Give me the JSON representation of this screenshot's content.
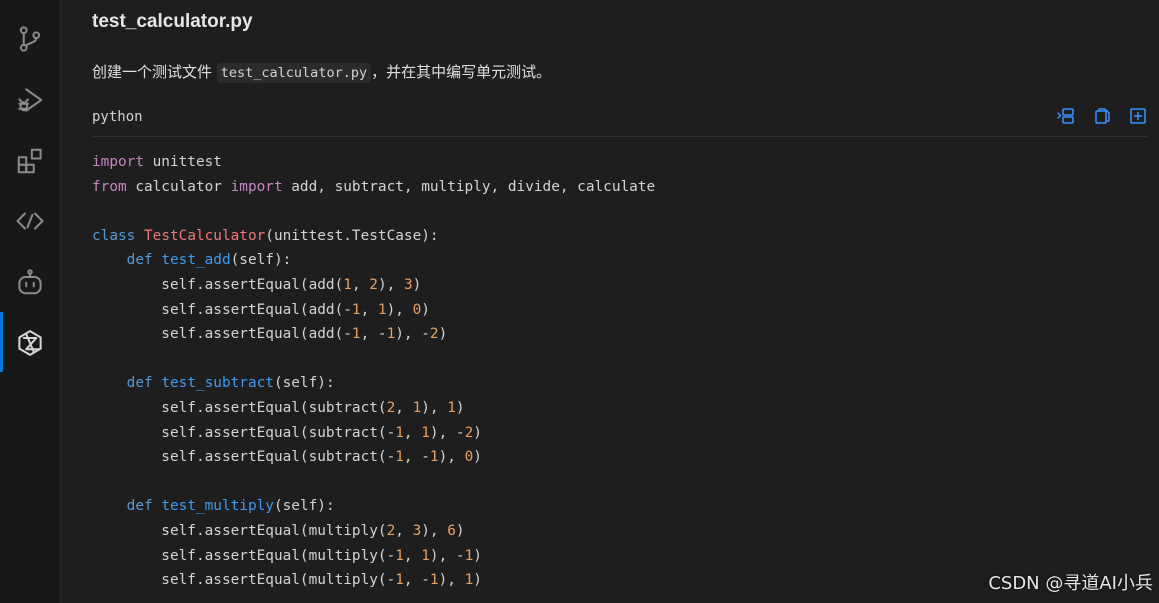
{
  "activity_bar": {
    "items": [
      {
        "name": "source-control-icon"
      },
      {
        "name": "run-debug-icon"
      },
      {
        "name": "extensions-icon"
      },
      {
        "name": "remote-explorer-icon"
      },
      {
        "name": "copilot-icon"
      },
      {
        "name": "ai-assistant-icon"
      }
    ],
    "active_index": 5
  },
  "header": {
    "title": "test_calculator.py"
  },
  "description": {
    "before": "创建一个测试文件 ",
    "code": "test_calculator.py",
    "after": "，并在其中编写单元测试。"
  },
  "code_block": {
    "language": "python",
    "actions": [
      "insert-at-cursor-icon",
      "copy-icon",
      "new-file-icon"
    ],
    "code": "import unittest\nfrom calculator import add, subtract, multiply, divide, calculate\n\nclass TestCalculator(unittest.TestCase):\n    def test_add(self):\n        self.assertEqual(add(1, 2), 3)\n        self.assertEqual(add(-1, 1), 0)\n        self.assertEqual(add(-1, -1), -2)\n\n    def test_subtract(self):\n        self.assertEqual(subtract(2, 1), 1)\n        self.assertEqual(subtract(-1, 1), -2)\n        self.assertEqual(subtract(-1, -1), 0)\n\n    def test_multiply(self):\n        self.assertEqual(multiply(2, 3), 6)\n        self.assertEqual(multiply(-1, 1), -1)\n        self.assertEqual(multiply(-1, -1), 1)"
  },
  "colors": {
    "accent": "#0078d4",
    "action_icon": "#3794ff",
    "keyword": "#c586c0",
    "storage": "#569cd6",
    "function": "#3c9cf2",
    "class": "#f07878",
    "number": "#e8a060"
  },
  "watermark": "CSDN @寻道AI小兵"
}
